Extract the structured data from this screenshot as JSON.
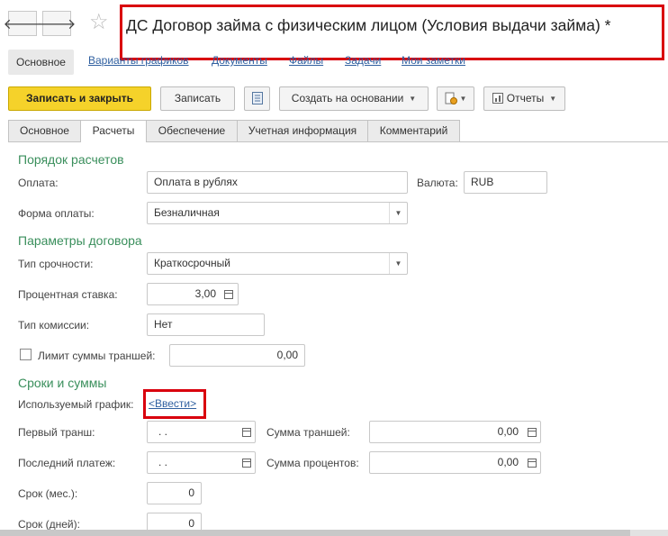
{
  "window": {
    "title": "ДС Договор займа с физическим лицом (Условия выдачи займа) *",
    "nav_back_icon": "arrow-left-icon",
    "nav_forward_icon": "arrow-right-icon",
    "favorite_icon": "star-icon"
  },
  "nav": {
    "active_tab": "Основное",
    "links": [
      "Варианты графиков",
      "Документы",
      "Файлы",
      "Задачи",
      "Мои заметки"
    ]
  },
  "toolbar": {
    "save_close": "Записать и закрыть",
    "save": "Записать",
    "create_based_on": "Создать на основании",
    "reports": "Отчеты"
  },
  "tabs": [
    "Основное",
    "Расчеты",
    "Обеспечение",
    "Учетная информация",
    "Комментарий"
  ],
  "active_tab_index": 1,
  "settlement": {
    "header": "Порядок расчетов",
    "payment_label": "Оплата:",
    "payment_value": "Оплата в рублях",
    "currency_label": "Валюта:",
    "currency_value": "RUB",
    "payment_form_label": "Форма оплаты:",
    "payment_form_value": "Безналичная"
  },
  "contract_params": {
    "header": "Параметры договора",
    "term_type_label": "Тип срочности:",
    "term_type_value": "Краткосрочный",
    "rate_label": "Процентная ставка:",
    "rate_value": "3,00",
    "commission_label": "Тип комиссии:",
    "commission_value": "Нет",
    "tranche_limit_label": "Лимит суммы траншей:",
    "tranche_limit_value": "0,00"
  },
  "terms": {
    "header": "Сроки и суммы",
    "schedule_label": "Используемый график:",
    "schedule_link": "<Ввести>",
    "first_tranche_label": "Первый транш:",
    "first_tranche_value": ". .",
    "tranche_sum_label": "Сумма траншей:",
    "tranche_sum_value": "0,00",
    "last_payment_label": "Последний платеж:",
    "last_payment_value": ". .",
    "interest_sum_label": "Сумма процентов:",
    "interest_sum_value": "0,00",
    "term_months_label": "Срок (мес.):",
    "term_months_value": "0",
    "term_days_label": "Срок (дней):",
    "term_days_value": "0"
  },
  "colors": {
    "accent": "#f5d22a",
    "section": "#3a8f5c",
    "highlight": "#d9000d",
    "link": "#3060a0"
  }
}
